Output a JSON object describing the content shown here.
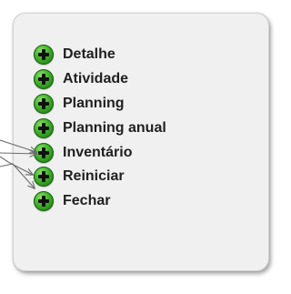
{
  "menu": {
    "items": [
      {
        "label": "Detalhe"
      },
      {
        "label": "Atividade"
      },
      {
        "label": "Planning"
      },
      {
        "label": "Planning anual"
      },
      {
        "label": "Inventário"
      },
      {
        "label": "Reiniciar"
      },
      {
        "label": "Fechar"
      }
    ]
  },
  "icons": {
    "item_icon": "plus-circle-icon",
    "annotation": "arrow-icon"
  },
  "colors": {
    "panel_background": "#f0f0f0",
    "panel_border": "#d2d2d2",
    "icon_green": "#45b52e",
    "icon_plus": "#111111",
    "label_text": "#1f1f1f",
    "annotation_arrow": "#6b6b6b"
  }
}
